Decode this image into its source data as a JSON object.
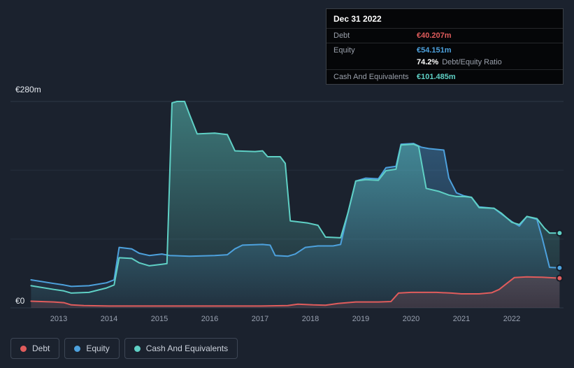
{
  "chart": {
    "y_top_label": "€280m",
    "y_zero_label": "€0",
    "x_ticks": [
      "2013",
      "2014",
      "2015",
      "2016",
      "2017",
      "2018",
      "2019",
      "2020",
      "2021",
      "2022"
    ]
  },
  "tooltip": {
    "date": "Dec 31 2022",
    "rows": [
      {
        "label": "Debt",
        "value": "€40.207m",
        "color": "#e05c5c"
      },
      {
        "label": "Equity",
        "value": "€54.151m",
        "color": "#4da1dd"
      },
      {
        "label": "",
        "value": "74.2%",
        "suffix": "Debt/Equity Ratio",
        "color": "#ffffff"
      },
      {
        "label": "Cash And Equivalents",
        "value": "€101.485m",
        "color": "#5fd0c5"
      }
    ]
  },
  "legend": [
    {
      "label": "Debt",
      "color": "#e05c5c"
    },
    {
      "label": "Equity",
      "color": "#4da1dd"
    },
    {
      "label": "Cash And Equivalents",
      "color": "#5fd0c5"
    }
  ],
  "chart_data": {
    "type": "area",
    "x_unit": "year",
    "xlim": [
      2012.4,
      2023.0
    ],
    "ylim": [
      0,
      280
    ],
    "y_currency": "EUR (millions)",
    "grid": "horizontal",
    "legend_position": "bottom-left",
    "series": [
      {
        "name": "Debt",
        "color": "#e05c5c",
        "points": [
          [
            2012.45,
            9
          ],
          [
            2012.9,
            8
          ],
          [
            2013.1,
            7
          ],
          [
            2013.25,
            4
          ],
          [
            2013.5,
            3
          ],
          [
            2014,
            2.5
          ],
          [
            2015,
            2.5
          ],
          [
            2016,
            2.5
          ],
          [
            2017,
            2.5
          ],
          [
            2017.55,
            3
          ],
          [
            2017.75,
            5
          ],
          [
            2018.05,
            4
          ],
          [
            2018.3,
            3.5
          ],
          [
            2018.55,
            6
          ],
          [
            2018.9,
            8
          ],
          [
            2019.35,
            8
          ],
          [
            2019.6,
            8.5
          ],
          [
            2019.75,
            20
          ],
          [
            2020,
            21
          ],
          [
            2020.5,
            21
          ],
          [
            2020.8,
            20
          ],
          [
            2021,
            19
          ],
          [
            2021.35,
            19
          ],
          [
            2021.6,
            20.5
          ],
          [
            2021.75,
            25
          ],
          [
            2021.9,
            33
          ],
          [
            2022.05,
            41
          ],
          [
            2022.3,
            42
          ],
          [
            2022.6,
            41.5
          ],
          [
            2022.95,
            40.207
          ]
        ]
      },
      {
        "name": "Equity",
        "color": "#4da1dd",
        "points": [
          [
            2012.45,
            38
          ],
          [
            2012.9,
            33
          ],
          [
            2013.1,
            31
          ],
          [
            2013.25,
            29
          ],
          [
            2013.6,
            30
          ],
          [
            2013.95,
            34
          ],
          [
            2014.1,
            38
          ],
          [
            2014.2,
            82
          ],
          [
            2014.45,
            80
          ],
          [
            2014.6,
            74
          ],
          [
            2014.8,
            71
          ],
          [
            2015.05,
            73
          ],
          [
            2015.2,
            71
          ],
          [
            2015.6,
            70
          ],
          [
            2016.1,
            71
          ],
          [
            2016.35,
            72
          ],
          [
            2016.5,
            80
          ],
          [
            2016.65,
            85
          ],
          [
            2017.05,
            86
          ],
          [
            2017.2,
            85
          ],
          [
            2017.3,
            71
          ],
          [
            2017.55,
            70
          ],
          [
            2017.7,
            73
          ],
          [
            2017.9,
            82
          ],
          [
            2018.15,
            84
          ],
          [
            2018.45,
            84
          ],
          [
            2018.6,
            86
          ],
          [
            2018.75,
            130
          ],
          [
            2018.9,
            172
          ],
          [
            2019.1,
            176
          ],
          [
            2019.35,
            175
          ],
          [
            2019.5,
            190
          ],
          [
            2019.7,
            192
          ],
          [
            2019.8,
            222
          ],
          [
            2020.05,
            223
          ],
          [
            2020.2,
            218
          ],
          [
            2020.35,
            216
          ],
          [
            2020.65,
            214
          ],
          [
            2020.75,
            176
          ],
          [
            2020.9,
            156
          ],
          [
            2021.05,
            152
          ],
          [
            2021.2,
            150
          ],
          [
            2021.35,
            137
          ],
          [
            2021.65,
            135
          ],
          [
            2021.8,
            127
          ],
          [
            2022,
            117
          ],
          [
            2022.15,
            111
          ],
          [
            2022.3,
            124
          ],
          [
            2022.5,
            120
          ],
          [
            2022.6,
            96
          ],
          [
            2022.75,
            55
          ],
          [
            2022.95,
            54.151
          ]
        ]
      },
      {
        "name": "Cash And Equivalents",
        "color": "#5fd0c5",
        "points": [
          [
            2012.45,
            30
          ],
          [
            2012.9,
            25
          ],
          [
            2013.1,
            23
          ],
          [
            2013.25,
            20
          ],
          [
            2013.6,
            21
          ],
          [
            2013.95,
            27
          ],
          [
            2014.1,
            31
          ],
          [
            2014.2,
            68
          ],
          [
            2014.45,
            67
          ],
          [
            2014.6,
            61
          ],
          [
            2014.8,
            57
          ],
          [
            2015.05,
            59
          ],
          [
            2015.15,
            60
          ],
          [
            2015.25,
            278
          ],
          [
            2015.35,
            280
          ],
          [
            2015.5,
            280
          ],
          [
            2015.6,
            262
          ],
          [
            2015.75,
            236
          ],
          [
            2016.1,
            237
          ],
          [
            2016.35,
            235
          ],
          [
            2016.5,
            213
          ],
          [
            2016.9,
            212
          ],
          [
            2017.05,
            213
          ],
          [
            2017.15,
            205
          ],
          [
            2017.4,
            205
          ],
          [
            2017.5,
            196
          ],
          [
            2017.6,
            118
          ],
          [
            2017.95,
            115
          ],
          [
            2018.15,
            112
          ],
          [
            2018.3,
            96
          ],
          [
            2018.6,
            95
          ],
          [
            2018.75,
            130
          ],
          [
            2018.9,
            172
          ],
          [
            2019.1,
            174
          ],
          [
            2019.35,
            173
          ],
          [
            2019.5,
            186
          ],
          [
            2019.7,
            188
          ],
          [
            2019.8,
            221
          ],
          [
            2020.05,
            222
          ],
          [
            2020.15,
            219
          ],
          [
            2020.3,
            162
          ],
          [
            2020.55,
            158
          ],
          [
            2020.75,
            153
          ],
          [
            2020.9,
            151
          ],
          [
            2021.05,
            151
          ],
          [
            2021.2,
            150
          ],
          [
            2021.35,
            136
          ],
          [
            2021.65,
            135
          ],
          [
            2021.8,
            128
          ],
          [
            2022,
            116
          ],
          [
            2022.15,
            113
          ],
          [
            2022.3,
            124
          ],
          [
            2022.5,
            121
          ],
          [
            2022.65,
            108
          ],
          [
            2022.75,
            101.485
          ],
          [
            2022.95,
            101.485
          ]
        ]
      }
    ]
  }
}
